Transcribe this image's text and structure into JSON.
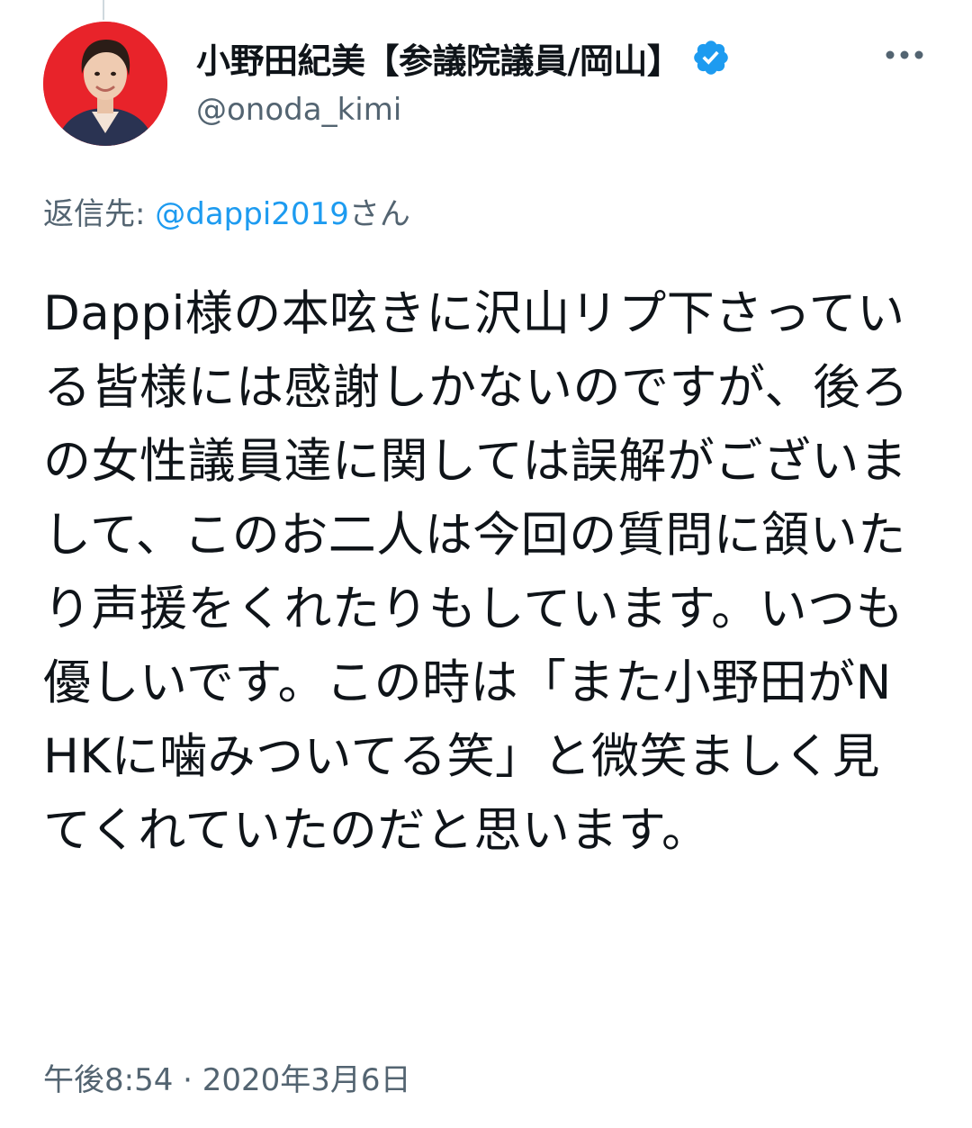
{
  "tweet": {
    "author": {
      "display_name": "小野田紀美【参議院議員/岡山】",
      "handle": "@onoda_kimi",
      "verified": true,
      "avatar_icon": "person-avatar"
    },
    "reply_to": {
      "prefix": "返信先: ",
      "handle": "@dappi2019",
      "suffix": "さん"
    },
    "text": "Dappi様の本呟きに沢山リプ下さっている皆様には感謝しかないのですが、後ろの女性議員達に関しては誤解がございまして、このお二人は今回の質問に頷いたり声援をくれたりもしています。いつも優しいです。この時は「また小野田がNHKに噛みついてる笑」と微笑ましく見てくれていたのだと思います。",
    "timestamp": "午後8:54 · 2020年3月6日"
  },
  "icons": {
    "verified": "verified-badge-icon",
    "more": "more-options-icon"
  },
  "colors": {
    "accent": "#1d9bf0",
    "secondary_text": "#536471",
    "avatar_background": "#e8232a"
  }
}
